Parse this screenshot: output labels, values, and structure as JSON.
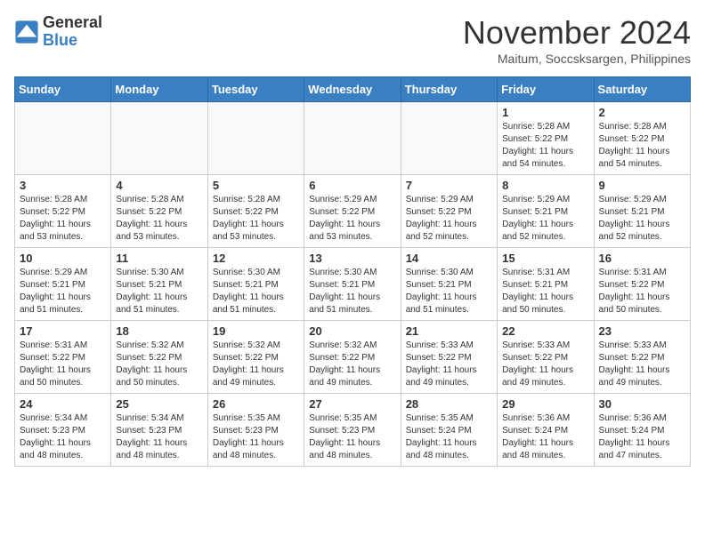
{
  "header": {
    "logo_line1": "General",
    "logo_line2": "Blue",
    "month_title": "November 2024",
    "location": "Maitum, Soccsksargen, Philippines"
  },
  "weekdays": [
    "Sunday",
    "Monday",
    "Tuesday",
    "Wednesday",
    "Thursday",
    "Friday",
    "Saturday"
  ],
  "weeks": [
    [
      {
        "day": "",
        "info": ""
      },
      {
        "day": "",
        "info": ""
      },
      {
        "day": "",
        "info": ""
      },
      {
        "day": "",
        "info": ""
      },
      {
        "day": "",
        "info": ""
      },
      {
        "day": "1",
        "info": "Sunrise: 5:28 AM\nSunset: 5:22 PM\nDaylight: 11 hours\nand 54 minutes."
      },
      {
        "day": "2",
        "info": "Sunrise: 5:28 AM\nSunset: 5:22 PM\nDaylight: 11 hours\nand 54 minutes."
      }
    ],
    [
      {
        "day": "3",
        "info": "Sunrise: 5:28 AM\nSunset: 5:22 PM\nDaylight: 11 hours\nand 53 minutes."
      },
      {
        "day": "4",
        "info": "Sunrise: 5:28 AM\nSunset: 5:22 PM\nDaylight: 11 hours\nand 53 minutes."
      },
      {
        "day": "5",
        "info": "Sunrise: 5:28 AM\nSunset: 5:22 PM\nDaylight: 11 hours\nand 53 minutes."
      },
      {
        "day": "6",
        "info": "Sunrise: 5:29 AM\nSunset: 5:22 PM\nDaylight: 11 hours\nand 53 minutes."
      },
      {
        "day": "7",
        "info": "Sunrise: 5:29 AM\nSunset: 5:22 PM\nDaylight: 11 hours\nand 52 minutes."
      },
      {
        "day": "8",
        "info": "Sunrise: 5:29 AM\nSunset: 5:21 PM\nDaylight: 11 hours\nand 52 minutes."
      },
      {
        "day": "9",
        "info": "Sunrise: 5:29 AM\nSunset: 5:21 PM\nDaylight: 11 hours\nand 52 minutes."
      }
    ],
    [
      {
        "day": "10",
        "info": "Sunrise: 5:29 AM\nSunset: 5:21 PM\nDaylight: 11 hours\nand 51 minutes."
      },
      {
        "day": "11",
        "info": "Sunrise: 5:30 AM\nSunset: 5:21 PM\nDaylight: 11 hours\nand 51 minutes."
      },
      {
        "day": "12",
        "info": "Sunrise: 5:30 AM\nSunset: 5:21 PM\nDaylight: 11 hours\nand 51 minutes."
      },
      {
        "day": "13",
        "info": "Sunrise: 5:30 AM\nSunset: 5:21 PM\nDaylight: 11 hours\nand 51 minutes."
      },
      {
        "day": "14",
        "info": "Sunrise: 5:30 AM\nSunset: 5:21 PM\nDaylight: 11 hours\nand 51 minutes."
      },
      {
        "day": "15",
        "info": "Sunrise: 5:31 AM\nSunset: 5:21 PM\nDaylight: 11 hours\nand 50 minutes."
      },
      {
        "day": "16",
        "info": "Sunrise: 5:31 AM\nSunset: 5:22 PM\nDaylight: 11 hours\nand 50 minutes."
      }
    ],
    [
      {
        "day": "17",
        "info": "Sunrise: 5:31 AM\nSunset: 5:22 PM\nDaylight: 11 hours\nand 50 minutes."
      },
      {
        "day": "18",
        "info": "Sunrise: 5:32 AM\nSunset: 5:22 PM\nDaylight: 11 hours\nand 50 minutes."
      },
      {
        "day": "19",
        "info": "Sunrise: 5:32 AM\nSunset: 5:22 PM\nDaylight: 11 hours\nand 49 minutes."
      },
      {
        "day": "20",
        "info": "Sunrise: 5:32 AM\nSunset: 5:22 PM\nDaylight: 11 hours\nand 49 minutes."
      },
      {
        "day": "21",
        "info": "Sunrise: 5:33 AM\nSunset: 5:22 PM\nDaylight: 11 hours\nand 49 minutes."
      },
      {
        "day": "22",
        "info": "Sunrise: 5:33 AM\nSunset: 5:22 PM\nDaylight: 11 hours\nand 49 minutes."
      },
      {
        "day": "23",
        "info": "Sunrise: 5:33 AM\nSunset: 5:22 PM\nDaylight: 11 hours\nand 49 minutes."
      }
    ],
    [
      {
        "day": "24",
        "info": "Sunrise: 5:34 AM\nSunset: 5:23 PM\nDaylight: 11 hours\nand 48 minutes."
      },
      {
        "day": "25",
        "info": "Sunrise: 5:34 AM\nSunset: 5:23 PM\nDaylight: 11 hours\nand 48 minutes."
      },
      {
        "day": "26",
        "info": "Sunrise: 5:35 AM\nSunset: 5:23 PM\nDaylight: 11 hours\nand 48 minutes."
      },
      {
        "day": "27",
        "info": "Sunrise: 5:35 AM\nSunset: 5:23 PM\nDaylight: 11 hours\nand 48 minutes."
      },
      {
        "day": "28",
        "info": "Sunrise: 5:35 AM\nSunset: 5:24 PM\nDaylight: 11 hours\nand 48 minutes."
      },
      {
        "day": "29",
        "info": "Sunrise: 5:36 AM\nSunset: 5:24 PM\nDaylight: 11 hours\nand 48 minutes."
      },
      {
        "day": "30",
        "info": "Sunrise: 5:36 AM\nSunset: 5:24 PM\nDaylight: 11 hours\nand 47 minutes."
      }
    ]
  ]
}
